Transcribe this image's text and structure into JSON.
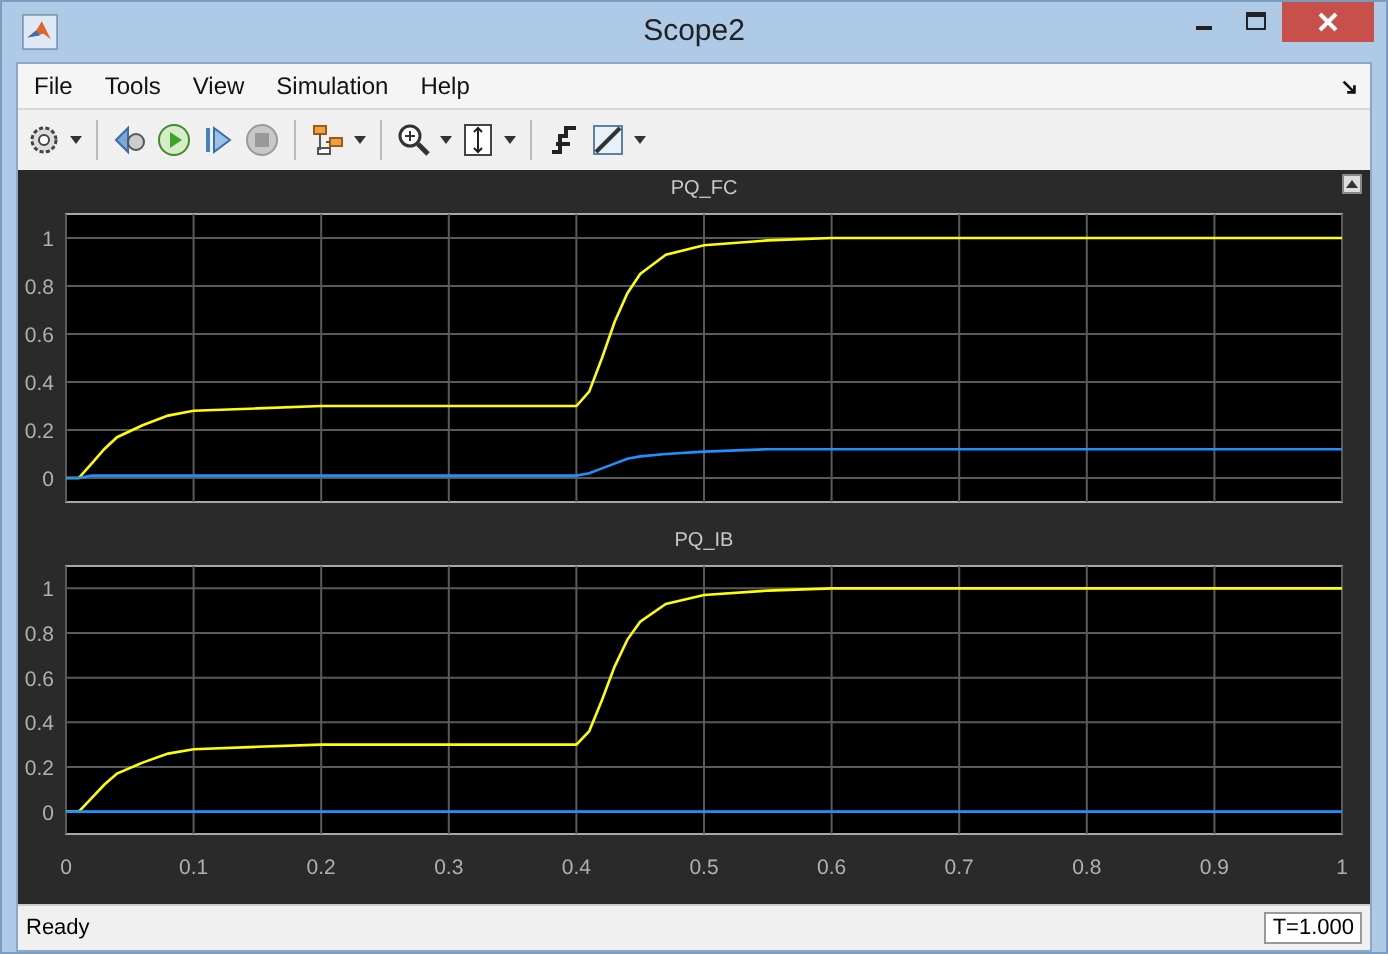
{
  "window": {
    "title": "Scope2"
  },
  "menu": [
    "File",
    "Tools",
    "View",
    "Simulation",
    "Help"
  ],
  "toolbar": [
    {
      "kind": "settings",
      "disabled": false
    },
    {
      "kind": "caret"
    },
    {
      "kind": "separator"
    },
    {
      "kind": "step_back",
      "disabled": false
    },
    {
      "kind": "run",
      "disabled": false
    },
    {
      "kind": "step_forward",
      "disabled": false
    },
    {
      "kind": "stop",
      "disabled": true
    },
    {
      "kind": "separator"
    },
    {
      "kind": "layout",
      "disabled": false
    },
    {
      "kind": "caret"
    },
    {
      "kind": "separator"
    },
    {
      "kind": "zoom",
      "disabled": false
    },
    {
      "kind": "caret"
    },
    {
      "kind": "scale",
      "disabled": false
    },
    {
      "kind": "caret"
    },
    {
      "kind": "separator"
    },
    {
      "kind": "trigger",
      "disabled": false
    },
    {
      "kind": "measure",
      "disabled": false
    },
    {
      "kind": "caret"
    }
  ],
  "plots": [
    {
      "chart_data": {
        "type": "line",
        "title": "PQ_FC",
        "grid": true,
        "x": [
          0,
          0.01,
          0.02,
          0.03,
          0.04,
          0.06,
          0.08,
          0.1,
          0.15,
          0.2,
          0.3,
          0.4,
          0.41,
          0.42,
          0.43,
          0.44,
          0.45,
          0.47,
          0.5,
          0.55,
          0.6,
          0.7,
          0.8,
          0.9,
          1
        ],
        "series": [
          {
            "color": "#ffff00",
            "values": [
              0,
              0,
              0.06,
              0.12,
              0.17,
              0.22,
              0.26,
              0.28,
              0.29,
              0.3,
              0.3,
              0.3,
              0.36,
              0.5,
              0.65,
              0.77,
              0.85,
              0.93,
              0.97,
              0.99,
              1,
              1,
              1,
              1,
              1
            ]
          },
          {
            "color": "#1e90ff",
            "values": [
              0,
              0,
              0.01,
              0.01,
              0.01,
              0.01,
              0.01,
              0.01,
              0.01,
              0.01,
              0.01,
              0.01,
              0.02,
              0.04,
              0.06,
              0.08,
              0.09,
              0.1,
              0.11,
              0.12,
              0.12,
              0.12,
              0.12,
              0.12,
              0.12
            ]
          }
        ],
        "xlim": [
          0,
          1
        ],
        "ylim": [
          -0.1,
          1.1
        ],
        "yticks": [
          0,
          0.2,
          0.4,
          0.6,
          0.8,
          1
        ]
      }
    },
    {
      "chart_data": {
        "type": "line",
        "title": "PQ_IB",
        "grid": true,
        "x": [
          0,
          0.01,
          0.02,
          0.03,
          0.04,
          0.06,
          0.08,
          0.1,
          0.15,
          0.2,
          0.3,
          0.4,
          0.41,
          0.42,
          0.43,
          0.44,
          0.45,
          0.47,
          0.5,
          0.55,
          0.6,
          0.7,
          0.8,
          0.9,
          1
        ],
        "series": [
          {
            "color": "#ffff00",
            "values": [
              0,
              0,
              0.06,
              0.12,
              0.17,
              0.22,
              0.26,
              0.28,
              0.29,
              0.3,
              0.3,
              0.3,
              0.36,
              0.5,
              0.65,
              0.77,
              0.85,
              0.93,
              0.97,
              0.99,
              1,
              1,
              1,
              1,
              1
            ]
          },
          {
            "color": "#1e90ff",
            "values": [
              0,
              0,
              0,
              0,
              0,
              0,
              0,
              0,
              0,
              0,
              0,
              0,
              0,
              0,
              0,
              0,
              0,
              0,
              0,
              0,
              0,
              0,
              0,
              0,
              0
            ]
          }
        ],
        "xlim": [
          0,
          1
        ],
        "ylim": [
          -0.1,
          1.1
        ],
        "xticks": [
          0,
          0.1,
          0.2,
          0.3,
          0.4,
          0.5,
          0.6,
          0.7,
          0.8,
          0.9,
          1
        ],
        "yticks": [
          0,
          0.2,
          0.4,
          0.6,
          0.8,
          1
        ]
      }
    }
  ],
  "status_bar": {
    "message": "Ready",
    "time": "T=1.000"
  }
}
